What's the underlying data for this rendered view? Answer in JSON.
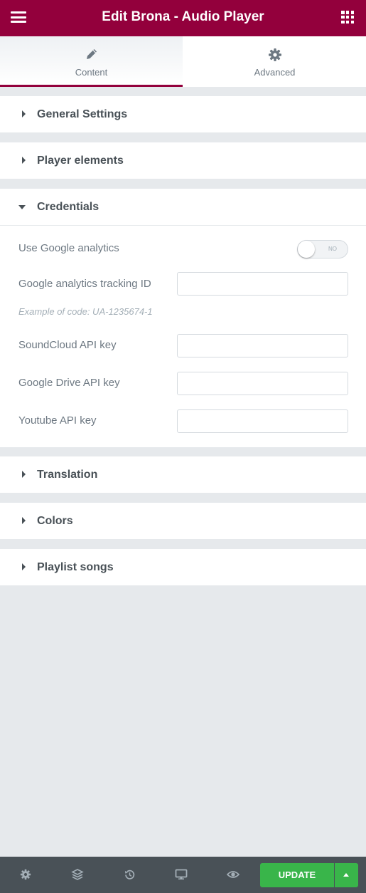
{
  "header": {
    "title": "Edit Brona - Audio Player",
    "menu_icon": "hamburger-icon",
    "widgets_icon": "grid-icon"
  },
  "tabs": [
    {
      "label": "Content",
      "icon": "pencil-icon",
      "active": true
    },
    {
      "label": "Advanced",
      "icon": "gear-icon",
      "active": false
    }
  ],
  "sections": {
    "general": "General Settings",
    "player": "Player elements",
    "credentials": "Credentials",
    "translation": "Translation",
    "colors": "Colors",
    "playlist": "Playlist songs"
  },
  "credentials": {
    "analytics_label": "Use Google analytics",
    "analytics_toggle": "NO",
    "tracking_label": "Google analytics tracking ID",
    "tracking_value": "",
    "tracking_hint": "Example of code: UA-1235674-1",
    "soundcloud_label": "SoundCloud API key",
    "soundcloud_value": "",
    "drive_label": "Google Drive API key",
    "drive_value": "",
    "youtube_label": "Youtube API key",
    "youtube_value": ""
  },
  "footer": {
    "icons": [
      "settings-icon",
      "layers-icon",
      "history-icon",
      "responsive-icon",
      "preview-icon"
    ],
    "update_label": "UPDATE"
  },
  "colors": {
    "brand": "#93003c",
    "update": "#39b54a",
    "footer": "#495157",
    "panel_bg": "#e6e9ec"
  }
}
